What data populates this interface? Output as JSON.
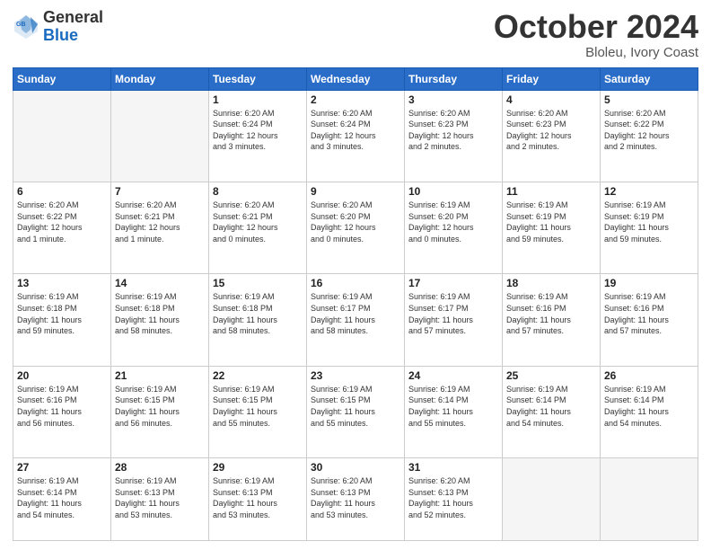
{
  "logo": {
    "general": "General",
    "blue": "Blue"
  },
  "header": {
    "month": "October 2024",
    "location": "Bloleu, Ivory Coast"
  },
  "weekdays": [
    "Sunday",
    "Monday",
    "Tuesday",
    "Wednesday",
    "Thursday",
    "Friday",
    "Saturday"
  ],
  "weeks": [
    [
      {
        "day": "",
        "info": ""
      },
      {
        "day": "",
        "info": ""
      },
      {
        "day": "1",
        "info": "Sunrise: 6:20 AM\nSunset: 6:24 PM\nDaylight: 12 hours\nand 3 minutes."
      },
      {
        "day": "2",
        "info": "Sunrise: 6:20 AM\nSunset: 6:24 PM\nDaylight: 12 hours\nand 3 minutes."
      },
      {
        "day": "3",
        "info": "Sunrise: 6:20 AM\nSunset: 6:23 PM\nDaylight: 12 hours\nand 2 minutes."
      },
      {
        "day": "4",
        "info": "Sunrise: 6:20 AM\nSunset: 6:23 PM\nDaylight: 12 hours\nand 2 minutes."
      },
      {
        "day": "5",
        "info": "Sunrise: 6:20 AM\nSunset: 6:22 PM\nDaylight: 12 hours\nand 2 minutes."
      }
    ],
    [
      {
        "day": "6",
        "info": "Sunrise: 6:20 AM\nSunset: 6:22 PM\nDaylight: 12 hours\nand 1 minute."
      },
      {
        "day": "7",
        "info": "Sunrise: 6:20 AM\nSunset: 6:21 PM\nDaylight: 12 hours\nand 1 minute."
      },
      {
        "day": "8",
        "info": "Sunrise: 6:20 AM\nSunset: 6:21 PM\nDaylight: 12 hours\nand 0 minutes."
      },
      {
        "day": "9",
        "info": "Sunrise: 6:20 AM\nSunset: 6:20 PM\nDaylight: 12 hours\nand 0 minutes."
      },
      {
        "day": "10",
        "info": "Sunrise: 6:19 AM\nSunset: 6:20 PM\nDaylight: 12 hours\nand 0 minutes."
      },
      {
        "day": "11",
        "info": "Sunrise: 6:19 AM\nSunset: 6:19 PM\nDaylight: 11 hours\nand 59 minutes."
      },
      {
        "day": "12",
        "info": "Sunrise: 6:19 AM\nSunset: 6:19 PM\nDaylight: 11 hours\nand 59 minutes."
      }
    ],
    [
      {
        "day": "13",
        "info": "Sunrise: 6:19 AM\nSunset: 6:18 PM\nDaylight: 11 hours\nand 59 minutes."
      },
      {
        "day": "14",
        "info": "Sunrise: 6:19 AM\nSunset: 6:18 PM\nDaylight: 11 hours\nand 58 minutes."
      },
      {
        "day": "15",
        "info": "Sunrise: 6:19 AM\nSunset: 6:18 PM\nDaylight: 11 hours\nand 58 minutes."
      },
      {
        "day": "16",
        "info": "Sunrise: 6:19 AM\nSunset: 6:17 PM\nDaylight: 11 hours\nand 58 minutes."
      },
      {
        "day": "17",
        "info": "Sunrise: 6:19 AM\nSunset: 6:17 PM\nDaylight: 11 hours\nand 57 minutes."
      },
      {
        "day": "18",
        "info": "Sunrise: 6:19 AM\nSunset: 6:16 PM\nDaylight: 11 hours\nand 57 minutes."
      },
      {
        "day": "19",
        "info": "Sunrise: 6:19 AM\nSunset: 6:16 PM\nDaylight: 11 hours\nand 57 minutes."
      }
    ],
    [
      {
        "day": "20",
        "info": "Sunrise: 6:19 AM\nSunset: 6:16 PM\nDaylight: 11 hours\nand 56 minutes."
      },
      {
        "day": "21",
        "info": "Sunrise: 6:19 AM\nSunset: 6:15 PM\nDaylight: 11 hours\nand 56 minutes."
      },
      {
        "day": "22",
        "info": "Sunrise: 6:19 AM\nSunset: 6:15 PM\nDaylight: 11 hours\nand 55 minutes."
      },
      {
        "day": "23",
        "info": "Sunrise: 6:19 AM\nSunset: 6:15 PM\nDaylight: 11 hours\nand 55 minutes."
      },
      {
        "day": "24",
        "info": "Sunrise: 6:19 AM\nSunset: 6:14 PM\nDaylight: 11 hours\nand 55 minutes."
      },
      {
        "day": "25",
        "info": "Sunrise: 6:19 AM\nSunset: 6:14 PM\nDaylight: 11 hours\nand 54 minutes."
      },
      {
        "day": "26",
        "info": "Sunrise: 6:19 AM\nSunset: 6:14 PM\nDaylight: 11 hours\nand 54 minutes."
      }
    ],
    [
      {
        "day": "27",
        "info": "Sunrise: 6:19 AM\nSunset: 6:14 PM\nDaylight: 11 hours\nand 54 minutes."
      },
      {
        "day": "28",
        "info": "Sunrise: 6:19 AM\nSunset: 6:13 PM\nDaylight: 11 hours\nand 53 minutes."
      },
      {
        "day": "29",
        "info": "Sunrise: 6:19 AM\nSunset: 6:13 PM\nDaylight: 11 hours\nand 53 minutes."
      },
      {
        "day": "30",
        "info": "Sunrise: 6:20 AM\nSunset: 6:13 PM\nDaylight: 11 hours\nand 53 minutes."
      },
      {
        "day": "31",
        "info": "Sunrise: 6:20 AM\nSunset: 6:13 PM\nDaylight: 11 hours\nand 52 minutes."
      },
      {
        "day": "",
        "info": ""
      },
      {
        "day": "",
        "info": ""
      }
    ]
  ]
}
